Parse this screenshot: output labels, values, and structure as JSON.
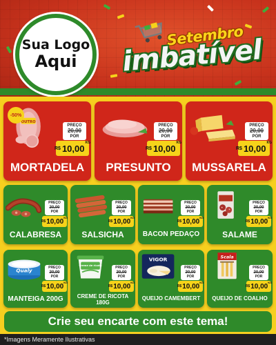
{
  "header": {
    "logo_line1": "Sua Logo",
    "logo_line2": "Aqui",
    "title_top": "Setembro",
    "title_main": "imbatível"
  },
  "price_labels": {
    "preco": "PREÇO",
    "por": "POR",
    "currency": "R$",
    "unit": "KG"
  },
  "featured_products": [
    {
      "name": "MORTADELA",
      "old_price": "20,00",
      "new_price": "10,00",
      "discount": "-50%",
      "brand": "OUTRO"
    },
    {
      "name": "PRESUNTO",
      "old_price": "20,00",
      "new_price": "10,00"
    },
    {
      "name": "MUSSARELA",
      "old_price": "20,00",
      "new_price": "10,00"
    }
  ],
  "row2_products": [
    {
      "name": "CALABRESA",
      "old_price": "20,00",
      "new_price": "10,00"
    },
    {
      "name": "SALSICHA",
      "old_price": "20,00",
      "new_price": "10,00"
    },
    {
      "name": "BACON PEDAÇO",
      "old_price": "20,00",
      "new_price": "10,00"
    },
    {
      "name": "SALAME",
      "old_price": "20,00",
      "new_price": "10,00"
    }
  ],
  "row3_products": [
    {
      "name": "MANTEIGA 200G",
      "old_price": "20,00",
      "new_price": "10,00",
      "brand": "Qualy"
    },
    {
      "name_line1": "CREME DE RICOTA",
      "name_line2": "180G",
      "old_price": "20,00",
      "new_price": "10,00",
      "brand": "Creme de ricota"
    },
    {
      "name": "QUEIJO CAMEMBERT",
      "old_price": "20,00",
      "new_price": "10,00",
      "brand": "VIGOR"
    },
    {
      "name": "QUEIJO DE COALHO",
      "old_price": "20,00",
      "new_price": "10,00",
      "brand": "Scala"
    }
  ],
  "footer": {
    "cta": "Crie seu encarte com este tema!",
    "disclaimer": "*Imagens Meramente Ilustrativas"
  },
  "colors": {
    "background_yellow": "#f6cf1f",
    "card_red": "#d0261a",
    "card_green": "#2f8a2a",
    "price_yellow": "#f6d31a"
  }
}
